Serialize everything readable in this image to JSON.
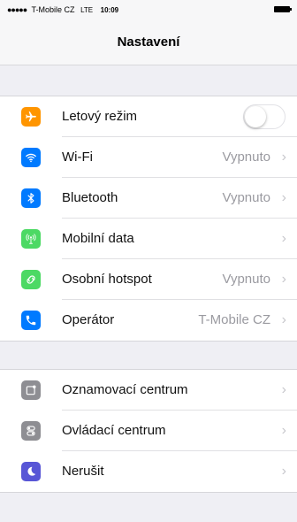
{
  "status_bar": {
    "signal": "●●●●●",
    "carrier": "T-Mobile CZ",
    "network": "LTE",
    "time": "10:09"
  },
  "nav": {
    "title": "Nastavení"
  },
  "section1": {
    "items": [
      {
        "label": "Letový režim",
        "icon": "airplane-icon",
        "color": "#ff9500",
        "toggle_on": false
      },
      {
        "label": "Wi-Fi",
        "icon": "wifi-icon",
        "color": "#007aff",
        "value": "Vypnuto"
      },
      {
        "label": "Bluetooth",
        "icon": "bluetooth-icon",
        "color": "#007aff",
        "value": "Vypnuto"
      },
      {
        "label": "Mobilní data",
        "icon": "antenna-icon",
        "color": "#4cd964",
        "value": ""
      },
      {
        "label": "Osobní hotspot",
        "icon": "hotspot-icon",
        "color": "#4cd964",
        "value": "Vypnuto"
      },
      {
        "label": "Operátor",
        "icon": "phone-icon",
        "color": "#007aff",
        "value": "T-Mobile CZ"
      }
    ]
  },
  "section2": {
    "items": [
      {
        "label": "Oznamovací centrum",
        "icon": "notification-center-icon",
        "color": "#8e8e93"
      },
      {
        "label": "Ovládací centrum",
        "icon": "control-center-icon",
        "color": "#8e8e93"
      },
      {
        "label": "Nerušit",
        "icon": "moon-icon",
        "color": "#5856d6"
      }
    ]
  },
  "chevron": "›"
}
